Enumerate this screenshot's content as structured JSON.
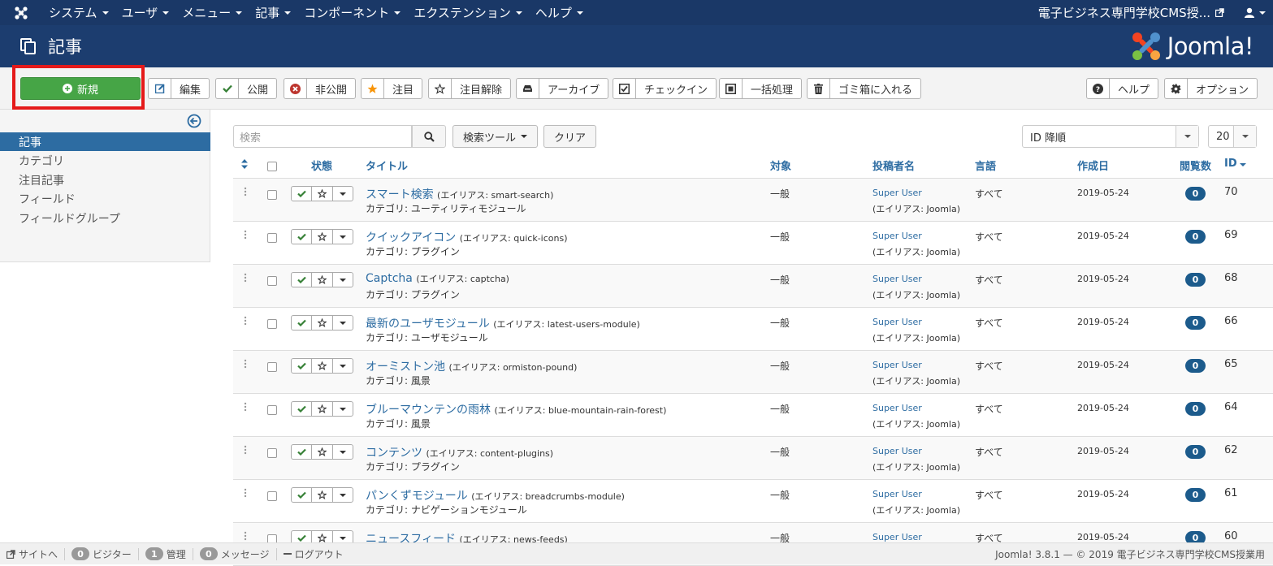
{
  "navbar": {
    "menus": [
      "システム",
      "ユーザ",
      "メニュー",
      "記事",
      "コンポーネント",
      "エクステンション",
      "ヘルプ"
    ],
    "site_name": "電子ビジネス専門学校CMS授..."
  },
  "header": {
    "title": "記事",
    "brand": "Joomla!"
  },
  "toolbar": {
    "new": "新規",
    "edit": "編集",
    "publish": "公開",
    "unpublish": "非公開",
    "feature": "注目",
    "unfeature": "注目解除",
    "archive": "アーカイブ",
    "checkin": "チェックイン",
    "batch": "一括処理",
    "trash": "ゴミ箱に入れる",
    "help": "ヘルプ",
    "options": "オプション"
  },
  "sidebar": {
    "items": [
      {
        "label": "記事",
        "active": true
      },
      {
        "label": "カテゴリ",
        "active": false
      },
      {
        "label": "注目記事",
        "active": false
      },
      {
        "label": "フィールド",
        "active": false
      },
      {
        "label": "フィールドグループ",
        "active": false
      }
    ]
  },
  "filters": {
    "search_placeholder": "検索",
    "search_tools": "検索ツール",
    "clear": "クリア",
    "ordering": "ID 降順",
    "limit": "20"
  },
  "table": {
    "headers": {
      "status": "状態",
      "title": "タイトル",
      "access": "対象",
      "author": "投稿者名",
      "language": "言語",
      "date": "作成日",
      "hits": "閲覧数",
      "id": "ID"
    },
    "rows": [
      {
        "title": "スマート検索",
        "alias": "(エイリアス: smart-search)",
        "category": "カテゴリ: ユーティリティモジュール",
        "access": "一般",
        "author": "Super User",
        "author_alias": "(エイリアス: Joomla)",
        "language": "すべて",
        "date": "2019-05-24",
        "hits": "0",
        "id": "70"
      },
      {
        "title": "クイックアイコン",
        "alias": "(エイリアス: quick-icons)",
        "category": "カテゴリ: プラグイン",
        "access": "一般",
        "author": "Super User",
        "author_alias": "(エイリアス: Joomla)",
        "language": "すべて",
        "date": "2019-05-24",
        "hits": "0",
        "id": "69"
      },
      {
        "title": "Captcha",
        "alias": "(エイリアス: captcha)",
        "category": "カテゴリ: プラグイン",
        "access": "一般",
        "author": "Super User",
        "author_alias": "(エイリアス: Joomla)",
        "language": "すべて",
        "date": "2019-05-24",
        "hits": "0",
        "id": "68"
      },
      {
        "title": "最新のユーザモジュール",
        "alias": "(エイリアス: latest-users-module)",
        "category": "カテゴリ: ユーザモジュール",
        "access": "一般",
        "author": "Super User",
        "author_alias": "(エイリアス: Joomla)",
        "language": "すべて",
        "date": "2019-05-24",
        "hits": "0",
        "id": "66"
      },
      {
        "title": "オーミストン池",
        "alias": "(エイリアス: ormiston-pound)",
        "category": "カテゴリ: 風景",
        "access": "一般",
        "author": "Super User",
        "author_alias": "(エイリアス: Joomla)",
        "language": "すべて",
        "date": "2019-05-24",
        "hits": "0",
        "id": "65"
      },
      {
        "title": "ブルーマウンテンの雨林",
        "alias": "(エイリアス: blue-mountain-rain-forest)",
        "category": "カテゴリ: 風景",
        "access": "一般",
        "author": "Super User",
        "author_alias": "(エイリアス: Joomla)",
        "language": "すべて",
        "date": "2019-05-24",
        "hits": "0",
        "id": "64"
      },
      {
        "title": "コンテンツ",
        "alias": "(エイリアス: content-plugins)",
        "category": "カテゴリ: プラグイン",
        "access": "一般",
        "author": "Super User",
        "author_alias": "(エイリアス: Joomla)",
        "language": "すべて",
        "date": "2019-05-24",
        "hits": "0",
        "id": "62"
      },
      {
        "title": "パンくずモジュール",
        "alias": "(エイリアス: breadcrumbs-module)",
        "category": "カテゴリ: ナビゲーションモジュール",
        "access": "一般",
        "author": "Super User",
        "author_alias": "(エイリアス: Joomla)",
        "language": "すべて",
        "date": "2019-05-24",
        "hits": "0",
        "id": "61"
      },
      {
        "title": "ニュースフィード",
        "alias": "(エイリアス: news-feeds)",
        "category": "",
        "access": "一般",
        "author": "Super User",
        "author_alias": "",
        "language": "すべて",
        "date": "2019-05-24",
        "hits": "0",
        "id": "60"
      }
    ]
  },
  "statusbar": {
    "site": "サイトへ",
    "visitors_count": "0",
    "visitors": "ビジター",
    "admins_count": "1",
    "admins": "管理",
    "messages_count": "0",
    "messages": "メッセージ",
    "logout": "ログアウト",
    "copyright": "Joomla! 3.8.1 — © 2019 電子ビジネス専門学校CMS授業用"
  },
  "colors": {
    "navbar": "#1a3867",
    "header": "#1c3d6f",
    "accent": "#2d6ca2",
    "new_button": "#46a546",
    "highlight": "#e51a1a"
  }
}
